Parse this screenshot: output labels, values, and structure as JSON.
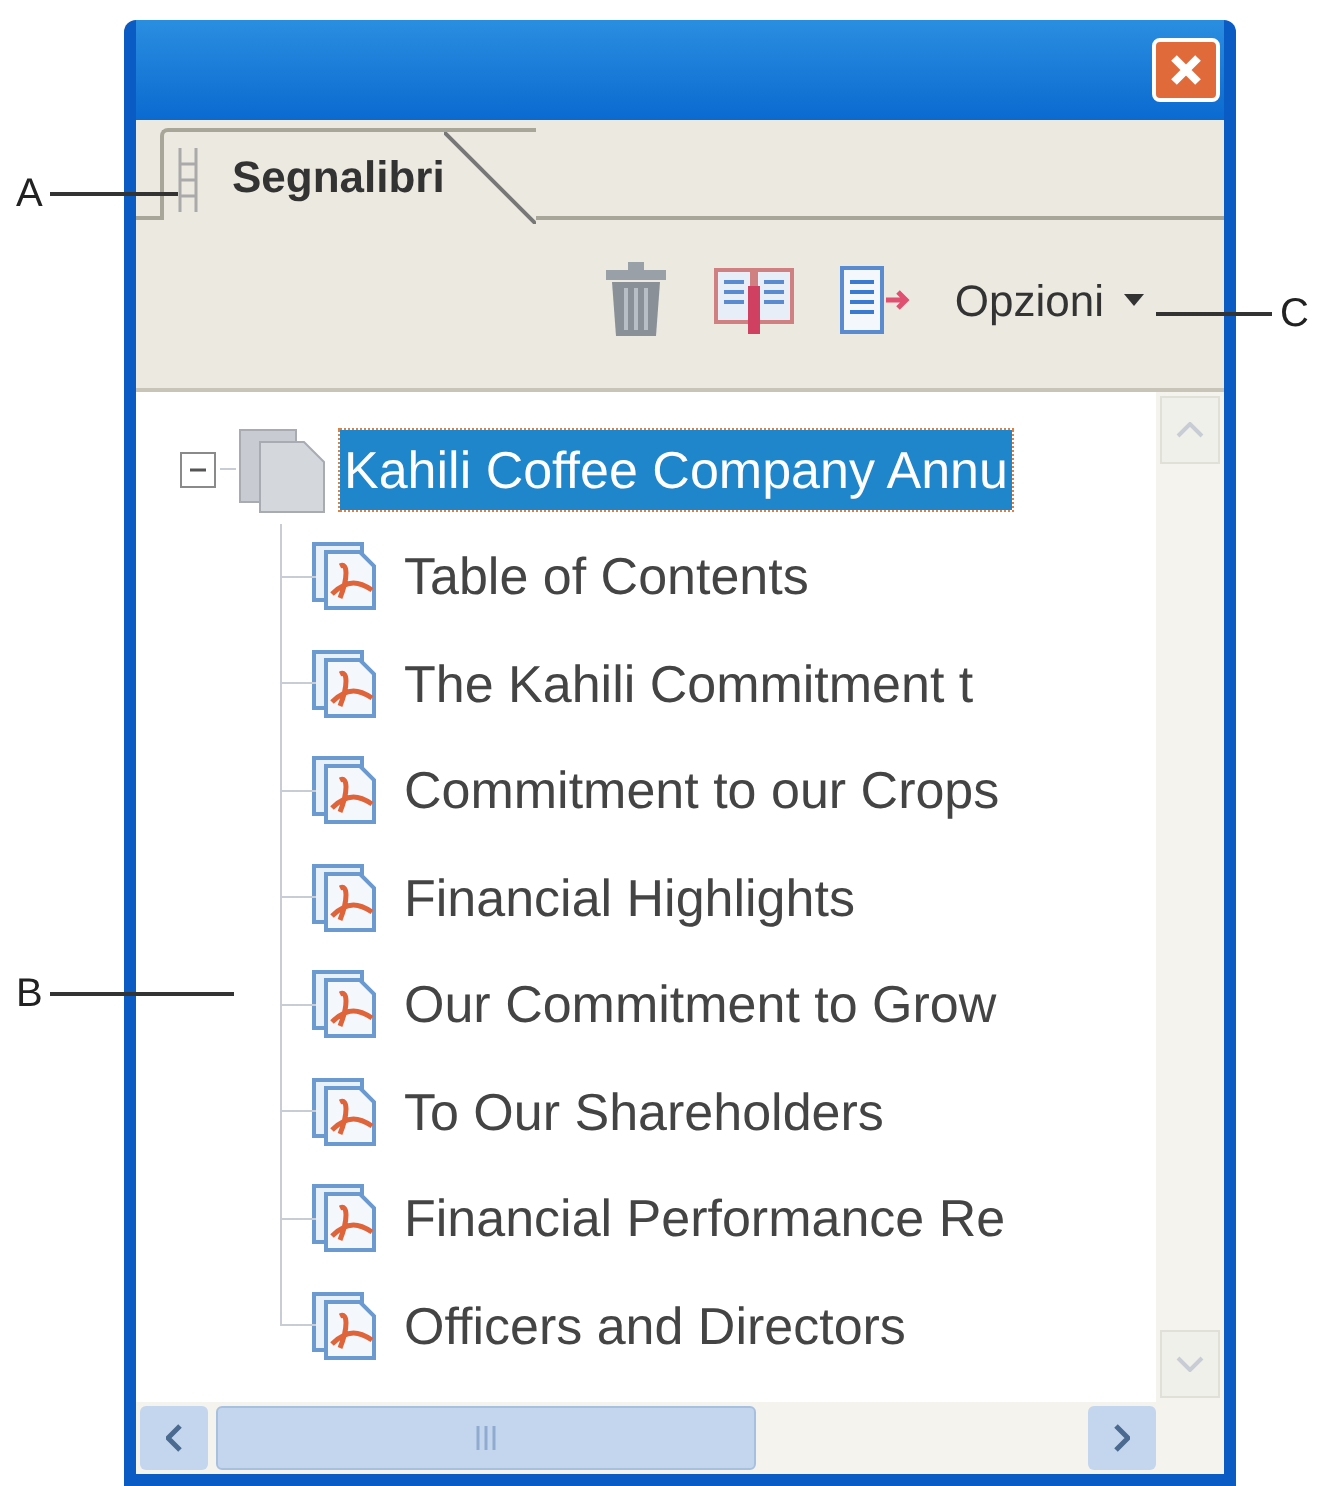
{
  "tabs": [
    {
      "label": "Segnalibri",
      "selected": true
    }
  ],
  "toolbar": {
    "options_menu": "Opzioni"
  },
  "bookmarks": [
    {
      "label": "Kahili Coffee Company Annu",
      "selected": true,
      "expanded": true,
      "kind": "document",
      "children": [
        {
          "label": "Table of Contents",
          "selected": false,
          "kind": "pdf"
        },
        {
          "label": "The Kahili Commitment t",
          "selected": false,
          "kind": "pdf"
        },
        {
          "label": "Commitment to our Crops",
          "selected": false,
          "kind": "pdf"
        },
        {
          "label": "Financial Highlights",
          "selected": false,
          "kind": "pdf"
        },
        {
          "label": "Our Commitment to Grow",
          "selected": false,
          "kind": "pdf"
        },
        {
          "label": "To Our Shareholders",
          "selected": false,
          "kind": "pdf"
        },
        {
          "label": "Financial Performance Re",
          "selected": false,
          "kind": "pdf"
        },
        {
          "label": "Officers and Directors",
          "selected": false,
          "kind": "pdf"
        }
      ]
    }
  ],
  "callouts": [
    "A",
    "C",
    "B"
  ]
}
